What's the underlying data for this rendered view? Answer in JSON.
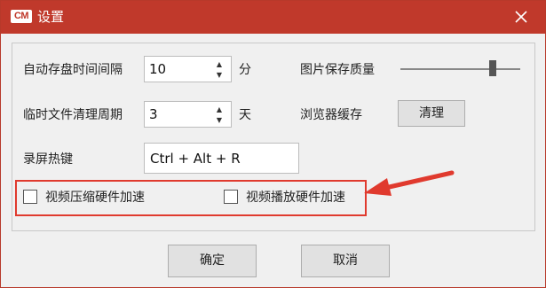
{
  "window": {
    "title": "设置",
    "logo": "CM",
    "accent": "#c0392b"
  },
  "settings": {
    "autosave_label": "自动存盘时间间隔",
    "autosave_value": "10",
    "autosave_unit": "分",
    "cleanup_label": "临时文件清理周期",
    "cleanup_value": "3",
    "cleanup_unit": "天",
    "hotkey_label": "录屏热键",
    "hotkey_value": "Ctrl + Alt + R",
    "image_quality_label": "图片保存质量",
    "image_quality_level": 0.77,
    "browser_cache_label": "浏览器缓存",
    "clear_button": "清理",
    "compress_hw_label": "视频压缩硬件加速",
    "compress_hw_checked": false,
    "playback_hw_label": "视频播放硬件加速",
    "playback_hw_checked": false
  },
  "footer": {
    "ok_label": "确定",
    "cancel_label": "取消"
  },
  "annotation": {
    "color": "#e03a2e"
  }
}
